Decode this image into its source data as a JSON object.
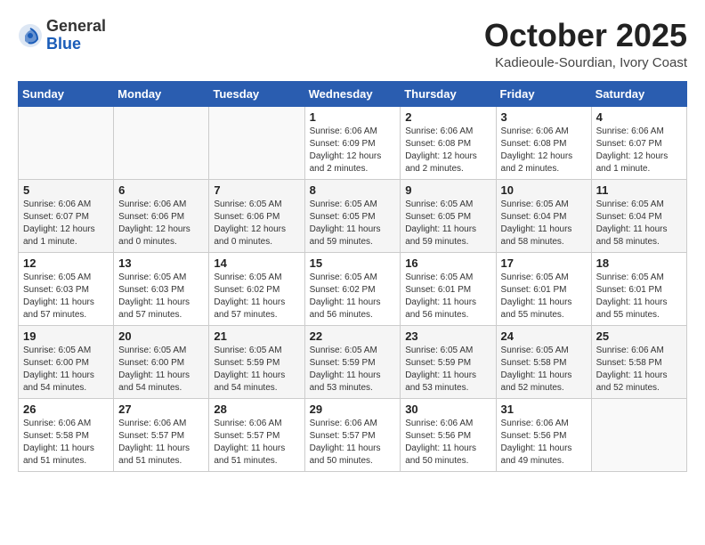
{
  "logo": {
    "general": "General",
    "blue": "Blue"
  },
  "header": {
    "month": "October 2025",
    "location": "Kadieoule-Sourdian, Ivory Coast"
  },
  "weekdays": [
    "Sunday",
    "Monday",
    "Tuesday",
    "Wednesday",
    "Thursday",
    "Friday",
    "Saturday"
  ],
  "weeks": [
    [
      {
        "day": "",
        "sunrise": "",
        "sunset": "",
        "daylight": ""
      },
      {
        "day": "",
        "sunrise": "",
        "sunset": "",
        "daylight": ""
      },
      {
        "day": "",
        "sunrise": "",
        "sunset": "",
        "daylight": ""
      },
      {
        "day": "1",
        "sunrise": "Sunrise: 6:06 AM",
        "sunset": "Sunset: 6:09 PM",
        "daylight": "Daylight: 12 hours and 2 minutes."
      },
      {
        "day": "2",
        "sunrise": "Sunrise: 6:06 AM",
        "sunset": "Sunset: 6:08 PM",
        "daylight": "Daylight: 12 hours and 2 minutes."
      },
      {
        "day": "3",
        "sunrise": "Sunrise: 6:06 AM",
        "sunset": "Sunset: 6:08 PM",
        "daylight": "Daylight: 12 hours and 2 minutes."
      },
      {
        "day": "4",
        "sunrise": "Sunrise: 6:06 AM",
        "sunset": "Sunset: 6:07 PM",
        "daylight": "Daylight: 12 hours and 1 minute."
      }
    ],
    [
      {
        "day": "5",
        "sunrise": "Sunrise: 6:06 AM",
        "sunset": "Sunset: 6:07 PM",
        "daylight": "Daylight: 12 hours and 1 minute."
      },
      {
        "day": "6",
        "sunrise": "Sunrise: 6:06 AM",
        "sunset": "Sunset: 6:06 PM",
        "daylight": "Daylight: 12 hours and 0 minutes."
      },
      {
        "day": "7",
        "sunrise": "Sunrise: 6:05 AM",
        "sunset": "Sunset: 6:06 PM",
        "daylight": "Daylight: 12 hours and 0 minutes."
      },
      {
        "day": "8",
        "sunrise": "Sunrise: 6:05 AM",
        "sunset": "Sunset: 6:05 PM",
        "daylight": "Daylight: 11 hours and 59 minutes."
      },
      {
        "day": "9",
        "sunrise": "Sunrise: 6:05 AM",
        "sunset": "Sunset: 6:05 PM",
        "daylight": "Daylight: 11 hours and 59 minutes."
      },
      {
        "day": "10",
        "sunrise": "Sunrise: 6:05 AM",
        "sunset": "Sunset: 6:04 PM",
        "daylight": "Daylight: 11 hours and 58 minutes."
      },
      {
        "day": "11",
        "sunrise": "Sunrise: 6:05 AM",
        "sunset": "Sunset: 6:04 PM",
        "daylight": "Daylight: 11 hours and 58 minutes."
      }
    ],
    [
      {
        "day": "12",
        "sunrise": "Sunrise: 6:05 AM",
        "sunset": "Sunset: 6:03 PM",
        "daylight": "Daylight: 11 hours and 57 minutes."
      },
      {
        "day": "13",
        "sunrise": "Sunrise: 6:05 AM",
        "sunset": "Sunset: 6:03 PM",
        "daylight": "Daylight: 11 hours and 57 minutes."
      },
      {
        "day": "14",
        "sunrise": "Sunrise: 6:05 AM",
        "sunset": "Sunset: 6:02 PM",
        "daylight": "Daylight: 11 hours and 57 minutes."
      },
      {
        "day": "15",
        "sunrise": "Sunrise: 6:05 AM",
        "sunset": "Sunset: 6:02 PM",
        "daylight": "Daylight: 11 hours and 56 minutes."
      },
      {
        "day": "16",
        "sunrise": "Sunrise: 6:05 AM",
        "sunset": "Sunset: 6:01 PM",
        "daylight": "Daylight: 11 hours and 56 minutes."
      },
      {
        "day": "17",
        "sunrise": "Sunrise: 6:05 AM",
        "sunset": "Sunset: 6:01 PM",
        "daylight": "Daylight: 11 hours and 55 minutes."
      },
      {
        "day": "18",
        "sunrise": "Sunrise: 6:05 AM",
        "sunset": "Sunset: 6:01 PM",
        "daylight": "Daylight: 11 hours and 55 minutes."
      }
    ],
    [
      {
        "day": "19",
        "sunrise": "Sunrise: 6:05 AM",
        "sunset": "Sunset: 6:00 PM",
        "daylight": "Daylight: 11 hours and 54 minutes."
      },
      {
        "day": "20",
        "sunrise": "Sunrise: 6:05 AM",
        "sunset": "Sunset: 6:00 PM",
        "daylight": "Daylight: 11 hours and 54 minutes."
      },
      {
        "day": "21",
        "sunrise": "Sunrise: 6:05 AM",
        "sunset": "Sunset: 5:59 PM",
        "daylight": "Daylight: 11 hours and 54 minutes."
      },
      {
        "day": "22",
        "sunrise": "Sunrise: 6:05 AM",
        "sunset": "Sunset: 5:59 PM",
        "daylight": "Daylight: 11 hours and 53 minutes."
      },
      {
        "day": "23",
        "sunrise": "Sunrise: 6:05 AM",
        "sunset": "Sunset: 5:59 PM",
        "daylight": "Daylight: 11 hours and 53 minutes."
      },
      {
        "day": "24",
        "sunrise": "Sunrise: 6:05 AM",
        "sunset": "Sunset: 5:58 PM",
        "daylight": "Daylight: 11 hours and 52 minutes."
      },
      {
        "day": "25",
        "sunrise": "Sunrise: 6:06 AM",
        "sunset": "Sunset: 5:58 PM",
        "daylight": "Daylight: 11 hours and 52 minutes."
      }
    ],
    [
      {
        "day": "26",
        "sunrise": "Sunrise: 6:06 AM",
        "sunset": "Sunset: 5:58 PM",
        "daylight": "Daylight: 11 hours and 51 minutes."
      },
      {
        "day": "27",
        "sunrise": "Sunrise: 6:06 AM",
        "sunset": "Sunset: 5:57 PM",
        "daylight": "Daylight: 11 hours and 51 minutes."
      },
      {
        "day": "28",
        "sunrise": "Sunrise: 6:06 AM",
        "sunset": "Sunset: 5:57 PM",
        "daylight": "Daylight: 11 hours and 51 minutes."
      },
      {
        "day": "29",
        "sunrise": "Sunrise: 6:06 AM",
        "sunset": "Sunset: 5:57 PM",
        "daylight": "Daylight: 11 hours and 50 minutes."
      },
      {
        "day": "30",
        "sunrise": "Sunrise: 6:06 AM",
        "sunset": "Sunset: 5:56 PM",
        "daylight": "Daylight: 11 hours and 50 minutes."
      },
      {
        "day": "31",
        "sunrise": "Sunrise: 6:06 AM",
        "sunset": "Sunset: 5:56 PM",
        "daylight": "Daylight: 11 hours and 49 minutes."
      },
      {
        "day": "",
        "sunrise": "",
        "sunset": "",
        "daylight": ""
      }
    ]
  ]
}
